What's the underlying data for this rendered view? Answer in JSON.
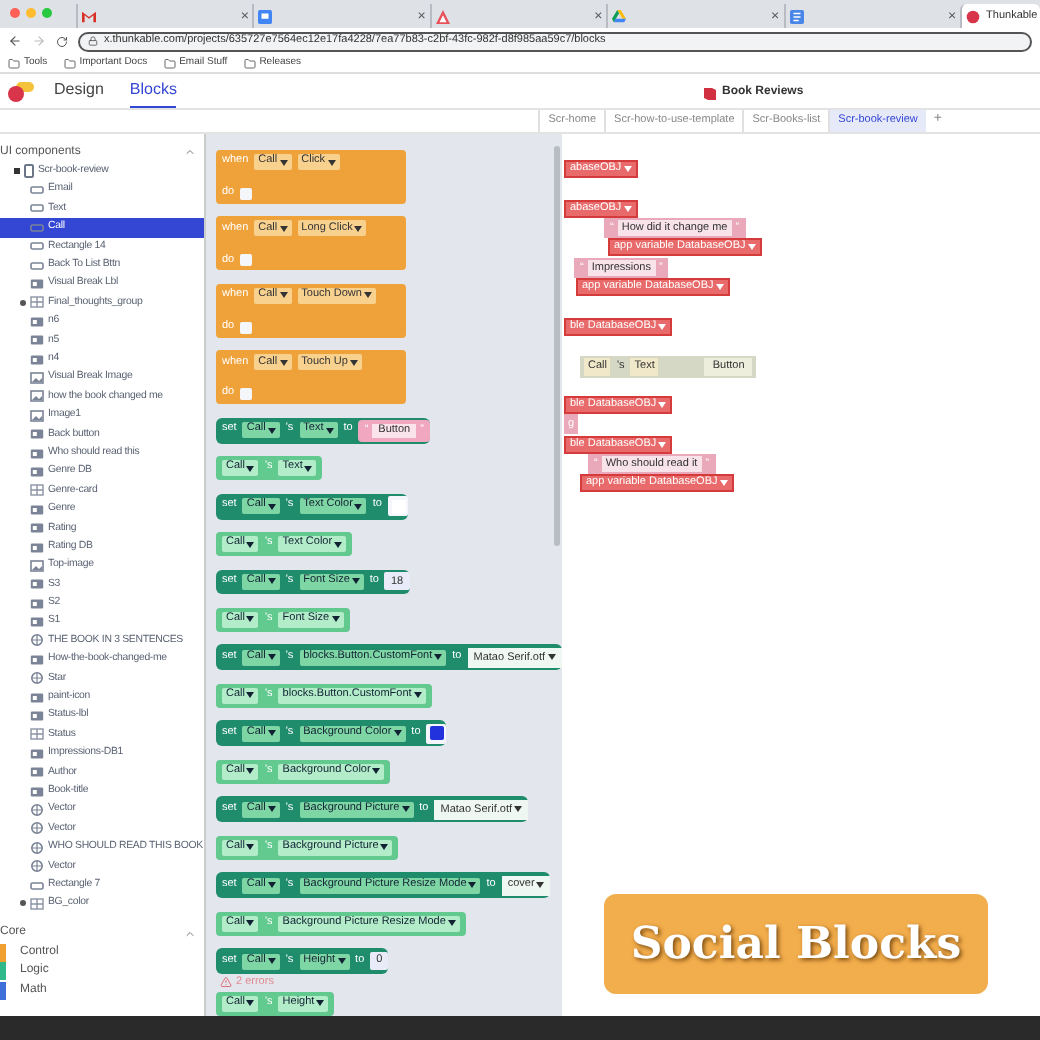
{
  "browser": {
    "tabs": [
      {
        "close": "×",
        "selected": false
      },
      {
        "close": "×",
        "selected": false
      },
      {
        "close": "×",
        "selected": false
      },
      {
        "close": "×",
        "selected": false
      },
      {
        "close": "×",
        "selected": false
      },
      {
        "title": "Thunkable",
        "selected": true
      }
    ],
    "url": "x.thunkable.com/projects/635727e7564ec12e17fa4228/7ea77b83-c2bf-43fc-982f-d8f985aa59c7/blocks",
    "bookmarks": [
      "Tools",
      "Important Docs",
      "Email Stuff",
      "Releases"
    ]
  },
  "app": {
    "modes": [
      {
        "label": "Design",
        "selected": false
      },
      {
        "label": "Blocks",
        "selected": true
      }
    ],
    "project": "Book Reviews",
    "screens": [
      {
        "label": "Scr-home",
        "selected": false
      },
      {
        "label": "Scr-how-to-use-template",
        "selected": false
      },
      {
        "label": "Scr-Books-list",
        "selected": false
      },
      {
        "label": "Scr-book-review",
        "selected": true
      }
    ],
    "add": "+"
  },
  "sidebar": {
    "title": "UI components",
    "tree": [
      {
        "label": "Scr-book-review",
        "kind": "screen",
        "expanded": true,
        "children": [
          {
            "label": "Email",
            "kind": "button",
            "selected": false
          },
          {
            "label": "Text",
            "kind": "button",
            "selected": false
          },
          {
            "label": "Call",
            "kind": "button",
            "selected": true
          },
          {
            "label": "Rectangle 14",
            "kind": "button",
            "selected": false
          },
          {
            "label": "Back To List Bttn",
            "kind": "button",
            "selected": false
          },
          {
            "label": "Visual Break Lbl",
            "kind": "label",
            "selected": false
          },
          {
            "label": "Final_thoughts_group",
            "kind": "group",
            "expanded": false,
            "selected": false
          },
          {
            "label": "n6",
            "kind": "label",
            "selected": false
          },
          {
            "label": "n5",
            "kind": "label",
            "selected": false
          },
          {
            "label": "n4",
            "kind": "label",
            "selected": false
          },
          {
            "label": "Visual Break Image",
            "kind": "image",
            "selected": false
          },
          {
            "label": "how the book changed me",
            "kind": "image",
            "selected": false
          },
          {
            "label": "Image1",
            "kind": "image",
            "selected": false
          },
          {
            "label": "Back button",
            "kind": "label",
            "selected": false
          },
          {
            "label": "Who should read this",
            "kind": "label",
            "selected": false
          },
          {
            "label": "Genre DB",
            "kind": "label",
            "selected": false
          },
          {
            "label": "Genre-card",
            "kind": "group",
            "selected": false
          },
          {
            "label": "Genre",
            "kind": "label",
            "selected": false
          },
          {
            "label": "Rating",
            "kind": "label",
            "selected": false
          },
          {
            "label": "Rating DB",
            "kind": "label",
            "selected": false
          },
          {
            "label": "Top-image",
            "kind": "image",
            "selected": false
          },
          {
            "label": "S3",
            "kind": "label",
            "selected": false
          },
          {
            "label": "S2",
            "kind": "label",
            "selected": false
          },
          {
            "label": "S1",
            "kind": "label",
            "selected": false
          },
          {
            "label": "THE BOOK IN 3 SENTENCES",
            "kind": "icon",
            "selected": false
          },
          {
            "label": "How-the-book-changed-me",
            "kind": "label",
            "selected": false
          },
          {
            "label": "Star",
            "kind": "icon",
            "selected": false
          },
          {
            "label": "paint-icon",
            "kind": "label",
            "selected": false
          },
          {
            "label": "Status-lbl",
            "kind": "label",
            "selected": false
          },
          {
            "label": "Status",
            "kind": "group",
            "selected": false
          },
          {
            "label": "Impressions-DB1",
            "kind": "label",
            "selected": false
          },
          {
            "label": "Author",
            "kind": "label",
            "selected": false
          },
          {
            "label": "Book-title",
            "kind": "label",
            "selected": false
          },
          {
            "label": "Vector",
            "kind": "icon",
            "selected": false
          },
          {
            "label": "Vector",
            "kind": "icon",
            "selected": false
          },
          {
            "label": "WHO SHOULD READ THIS BOOK",
            "kind": "icon",
            "selected": false
          },
          {
            "label": "Vector",
            "kind": "icon",
            "selected": false
          },
          {
            "label": "Rectangle 7",
            "kind": "button",
            "selected": false
          },
          {
            "label": "BG_color",
            "kind": "group",
            "expanded": false,
            "selected": false
          }
        ]
      }
    ],
    "core_title": "Core",
    "core": [
      {
        "label": "Control",
        "color": "#f0a030"
      },
      {
        "label": "Logic",
        "color": "#2fb88a"
      },
      {
        "label": "Math",
        "color": "#3f6fd8"
      }
    ]
  },
  "flyout": {
    "blocks": [
      {
        "kind": "event",
        "when": "when",
        "component": "Call",
        "event": "Click",
        "do": "do"
      },
      {
        "kind": "event",
        "when": "when",
        "component": "Call",
        "event": "Long Click",
        "do": "do"
      },
      {
        "kind": "event",
        "when": "when",
        "component": "Call",
        "event": "Touch Down",
        "do": "do"
      },
      {
        "kind": "event",
        "when": "when",
        "component": "Call",
        "event": "Touch Up",
        "do": "do"
      },
      {
        "kind": "set",
        "set": "set",
        "component": "Call",
        "s": "'s",
        "property": "Text",
        "to": "to",
        "value": {
          "kind": "text",
          "open": "“",
          "text": "Button",
          "close": "”"
        }
      },
      {
        "kind": "get",
        "component": "Call",
        "s": "'s",
        "property": "Text"
      },
      {
        "kind": "set",
        "set": "set",
        "component": "Call",
        "s": "'s",
        "property": "Text Color",
        "to": "to",
        "value": {
          "kind": "color",
          "color": "#ffffff"
        }
      },
      {
        "kind": "get",
        "component": "Call",
        "s": "'s",
        "property": "Text Color"
      },
      {
        "kind": "set",
        "set": "set",
        "component": "Call",
        "s": "'s",
        "property": "Font Size",
        "to": "to",
        "value": {
          "kind": "number",
          "text": "18"
        }
      },
      {
        "kind": "get",
        "component": "Call",
        "s": "'s",
        "property": "Font Size"
      },
      {
        "kind": "set",
        "set": "set",
        "component": "Call",
        "s": "'s",
        "property": "blocks.Button.CustomFont",
        "to": "to",
        "value": {
          "kind": "dropdown",
          "text": "Matao Serif.otf"
        }
      },
      {
        "kind": "get",
        "component": "Call",
        "s": "'s",
        "property": "blocks.Button.CustomFont"
      },
      {
        "kind": "set",
        "set": "set",
        "component": "Call",
        "s": "'s",
        "property": "Background Color",
        "to": "to",
        "value": {
          "kind": "color",
          "color": "#2233dd"
        }
      },
      {
        "kind": "get",
        "component": "Call",
        "s": "'s",
        "property": "Background Color"
      },
      {
        "kind": "set",
        "set": "set",
        "component": "Call",
        "s": "'s",
        "property": "Background Picture",
        "to": "to",
        "value": {
          "kind": "dropdown",
          "text": "Matao Serif.otf"
        }
      },
      {
        "kind": "get",
        "component": "Call",
        "s": "'s",
        "property": "Background Picture"
      },
      {
        "kind": "set",
        "set": "set",
        "component": "Call",
        "s": "'s",
        "property": "Background Picture Resize Mode",
        "to": "to",
        "value": {
          "kind": "dropdown",
          "text": "cover"
        }
      },
      {
        "kind": "get",
        "component": "Call",
        "s": "'s",
        "property": "Background Picture Resize Mode"
      },
      {
        "kind": "set",
        "set": "set",
        "component": "Call",
        "s": "'s",
        "property": "Height",
        "to": "to",
        "value": {
          "kind": "number",
          "text": "0"
        }
      },
      {
        "kind": "errors",
        "text": "2 errors"
      },
      {
        "kind": "get",
        "component": "Call",
        "s": "'s",
        "property": "Height"
      }
    ]
  },
  "workspace": {
    "fragments": [
      {
        "kind": "dropdown",
        "text": "abaseOBJ"
      },
      {
        "kind": "dropdown",
        "text": "abaseOBJ"
      },
      {
        "kind": "string",
        "open": "“",
        "text": "How did it change me",
        "close": "”"
      },
      {
        "kind": "dropdown",
        "text": "app variable DatabaseOBJ"
      },
      {
        "kind": "string",
        "open": "“",
        "text": "Impressions",
        "close": "”"
      },
      {
        "kind": "dropdown",
        "text": "app variable DatabaseOBJ"
      },
      {
        "kind": "dropdown",
        "text": "ble DatabaseOBJ"
      },
      {
        "kind": "ghost",
        "component": "Call",
        "s": "'s",
        "property": "Text",
        "value": "Button"
      },
      {
        "kind": "dropdown",
        "text": "ble DatabaseOBJ"
      },
      {
        "kind": "label",
        "text": "g"
      },
      {
        "kind": "dropdown",
        "text": "ble DatabaseOBJ"
      },
      {
        "kind": "string",
        "open": "“",
        "text": "Who should read it",
        "close": "”"
      },
      {
        "kind": "dropdown",
        "text": "app variable DatabaseOBJ"
      }
    ]
  },
  "caption": "Social Blocks"
}
